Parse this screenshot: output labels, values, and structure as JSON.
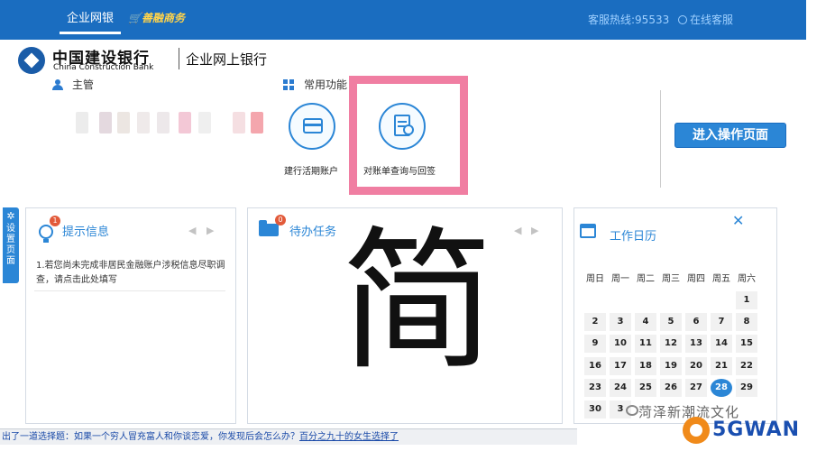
{
  "topbar": {
    "tab_active": "企业网银",
    "shop_link": "善融商务",
    "hotline": "客服热线:95533",
    "online_service": "在线客服",
    "color": "#1a6dc0"
  },
  "logo": {
    "bank_name_cn": "中国建设银行",
    "bank_name_en": "China Construction Bank",
    "product": "企业网上银行"
  },
  "manager": {
    "label": "主管"
  },
  "common_functions": {
    "label": "常用功能",
    "items": [
      {
        "label": "建行活期账户",
        "icon": "bank-card-icon"
      },
      {
        "label": "对账单查询与回签",
        "icon": "document-search-icon",
        "highlighted": true
      }
    ]
  },
  "operate_button": {
    "label": "进入操作页面"
  },
  "side_tab": {
    "label": "设置页面"
  },
  "notice_panel": {
    "title": "提示信息",
    "badge": "1",
    "items": [
      "1.若您尚未完成非居民金融账户涉税信息尽职调查，请点击此处填写"
    ]
  },
  "task_panel": {
    "title": "待办任务",
    "badge": "0"
  },
  "overlay_char": "简",
  "calendar": {
    "title": "工作日历",
    "weekdays": [
      "周日",
      "周一",
      "周二",
      "周三",
      "周四",
      "周五",
      "周六"
    ],
    "today": "28",
    "rows": [
      [
        "",
        "",
        "",
        "",
        "",
        "",
        "1"
      ],
      [
        "2",
        "3",
        "4",
        "5",
        "6",
        "7",
        "8"
      ],
      [
        "9",
        "10",
        "11",
        "12",
        "13",
        "14",
        "15"
      ],
      [
        "16",
        "17",
        "18",
        "19",
        "20",
        "21",
        "22"
      ],
      [
        "23",
        "24",
        "25",
        "26",
        "27",
        "28",
        "29"
      ],
      [
        "30",
        "3",
        "",
        "",
        "",
        "",
        ""
      ]
    ]
  },
  "status_bar": {
    "text": "出了一道选择题：如果一个穷人冒充富人和你谈恋爱，你发现后会怎么办？",
    "link": "百分之九十的女生选择了"
  },
  "watermarks": {
    "wechat_text": "菏泽新潮流文化",
    "site_logo": "5GWAN"
  }
}
